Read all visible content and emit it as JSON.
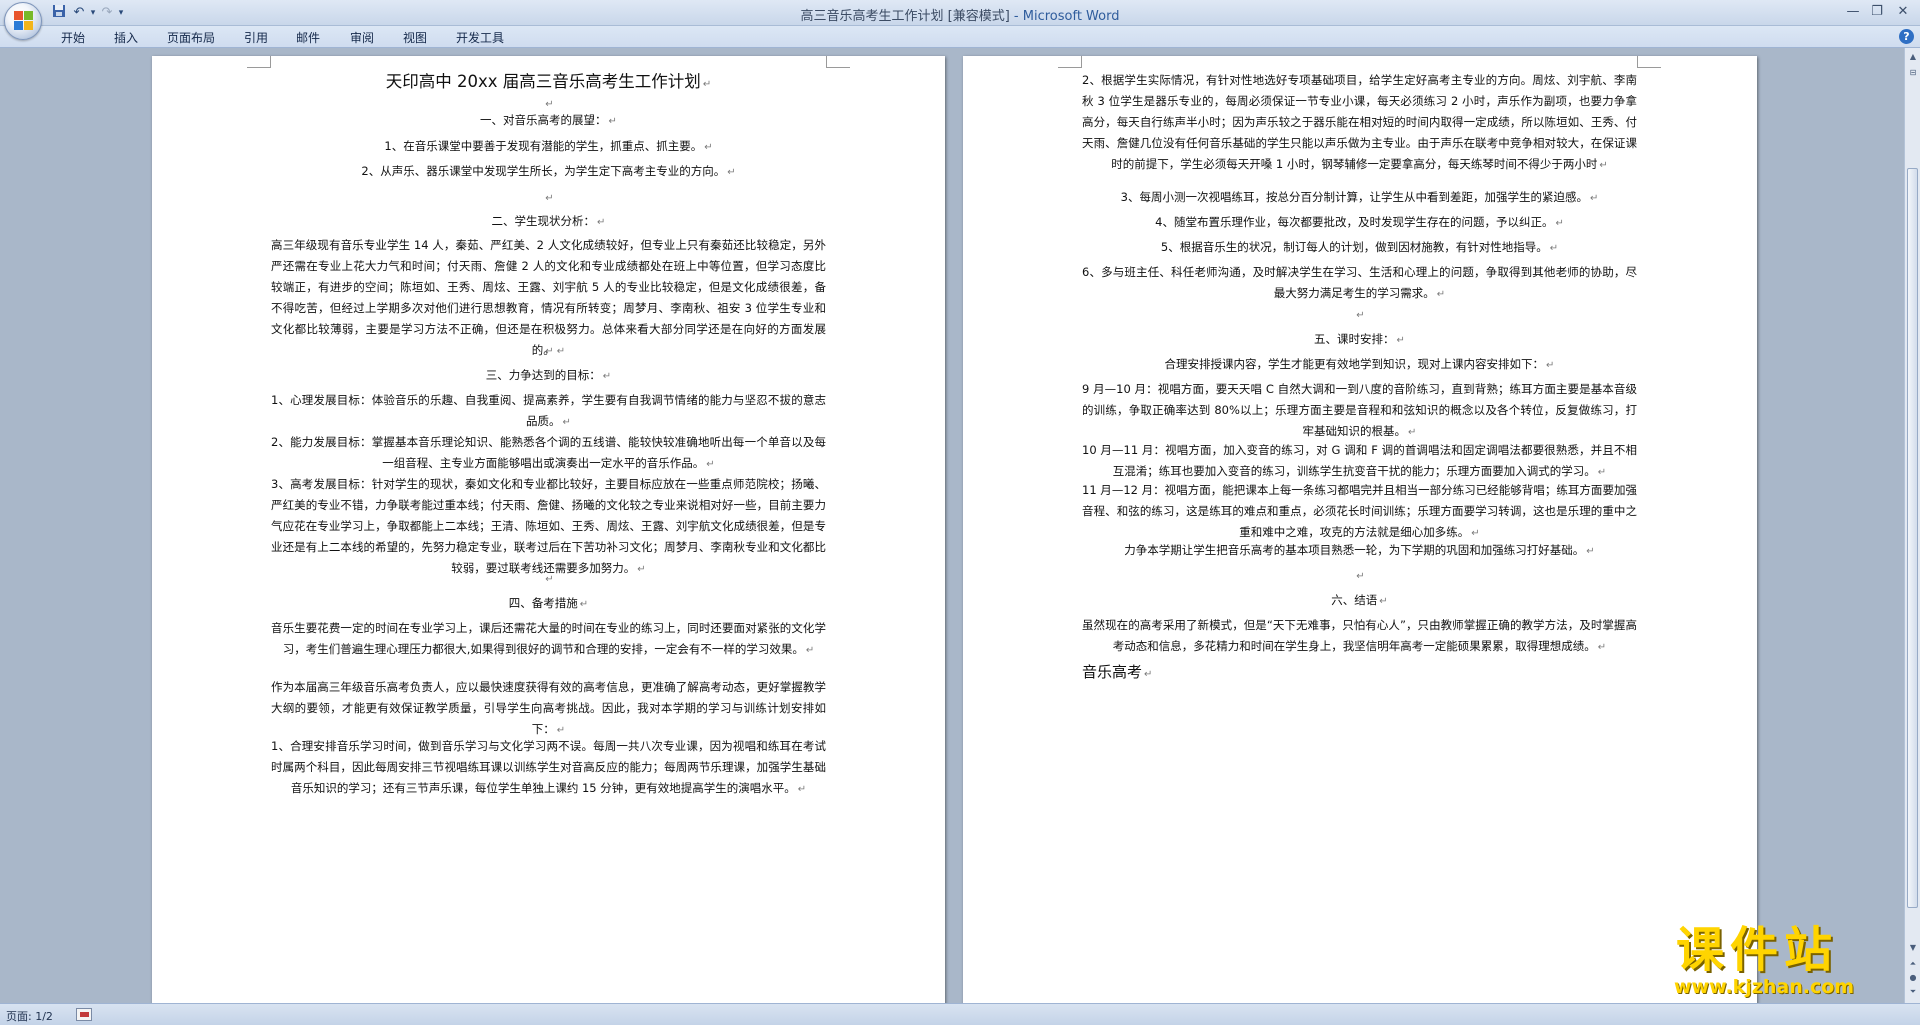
{
  "window": {
    "document_name": "高三音乐高考生工作计划 [兼容模式]",
    "separator": " - ",
    "app_name": "Microsoft Word"
  },
  "ribbon_tabs": [
    "开始",
    "插入",
    "页面布局",
    "引用",
    "邮件",
    "审阅",
    "视图",
    "开发工具"
  ],
  "status": {
    "page_indicator": "页面: 1/2"
  },
  "paragraph_mark": "↵",
  "page1": {
    "paragraphs": [
      {
        "text": "天印高中 20xx 届高三音乐高考生工作计划",
        "style": "title"
      },
      {
        "text": "",
        "style": "empty"
      },
      {
        "text": "一、对音乐高考的展望：",
        "style": "center"
      },
      {
        "text": "1、在音乐课堂中要善于发现有潜能的学生，抓重点、抓主要。",
        "style": "center"
      },
      {
        "text": "2、从声乐、器乐课堂中发现学生所长，为学生定下高考主专业的方向。",
        "style": "center"
      },
      {
        "text": "",
        "style": "empty"
      },
      {
        "text": "二、学生现状分析：",
        "style": "center"
      },
      {
        "text": "高三年级现有音乐专业学生 14 人，秦茹、严红美、2 人文化成绩较好，但专业上只有秦茹还比较稳定，另外严还需在专业上花大力气和时间；付天雨、詹健 2 人的文化和专业成绩都处在班上中等位置，但学习态度比较端正，有进步的空间；陈垣如、王秀、周炫、王露、刘宇航 5 人的专业比较稳定，但是文化成绩很差，备不得吃苦，但经过上学期多次对他们进行思想教育，情况有所转变；周梦月、李南秋、祖安 3 位学生专业和文化都比较薄弱，主要是学习方法不正确，但还是在积极努力。总体来看大部分同学还是在向好的方面发展的。",
        "style": "just"
      },
      {
        "text": "",
        "style": "empty"
      },
      {
        "text": "三、力争达到的目标：",
        "style": "center"
      },
      {
        "text": "1、心理发展目标：体验音乐的乐趣、自我重阅、提高素养，学生要有自我调节情绪的能力与坚忍不拔的意志品质。",
        "style": "just"
      },
      {
        "text": "2、能力发展目标：掌握基本音乐理论知识、能熟悉各个调的五线谱、能较快较准确地听出每一个单音以及每一组音程、主专业方面能够唱出或演奏出一定水平的音乐作品。",
        "style": "just"
      },
      {
        "text": "3、高考发展目标：针对学生的现状，秦如文化和专业都比较好，主要目标应放在一些重点师范院校；扬曦、严红美的专业不错，力争联考能过重本线；付天雨、詹健、扬曦的文化较之专业来说相对好一些，目前主要力气应花在专业学习上，争取都能上二本线；王清、陈垣如、王秀、周炫、王露、刘宇航文化成绩很差，但是专业还是有上二本线的希望的，先努力稳定专业，联考过后在下苦功补习文化；周梦月、李南秋专业和文化都比较弱，要过联考线还需要多加努力。",
        "style": "just"
      },
      {
        "text": "",
        "style": "empty"
      },
      {
        "text": "四、备考措施",
        "style": "center"
      },
      {
        "text": "音乐生要花费一定的时间在专业学习上，课后还需花大量的时间在专业的练习上，同时还要面对紧张的文化学习，考生们普遍生理心理压力都很大,如果得到很好的调节和合理的安排，一定会有不一样的学习效果。",
        "style": "just"
      },
      {
        "text": "作为本届高三年级音乐高考负责人，应以最快速度获得有效的高考信息，更准确了解高考动态，更好掌握教学大纲的要领，才能更有效保证教学质量，引导学生向高考挑战。因此，我对本学期的学习与训练计划安排如下：",
        "style": "just"
      },
      {
        "text": "1、合理安排音乐学习时间，做到音乐学习与文化学习两不误。每周一共八次专业课，因为视唱和练耳在考试时属两个科目，因此每周安排三节视唱练耳课以训练学生对音高反应的能力；每周两节乐理课，加强学生基础音乐知识的学习；还有三节声乐课，每位学生单独上课约 15 分钟，更有效地提高学生的演唱水平。",
        "style": "just"
      }
    ]
  },
  "page2": {
    "paragraphs": [
      {
        "text": "2、根据学生实际情况，有针对性地选好专项基础项目，给学生定好高考主专业的方向。周炫、刘宇航、李南秋 3 位学生是器乐专业的，每周必须保证一节专业小课，每天必须练习 2 小时，声乐作为副项，也要力争拿高分，每天自行练声半小时；因为声乐较之于器乐能在相对短的时间内取得一定成绩，所以陈垣如、王秀、付天雨、詹健几位没有任何音乐基础的学生只能以声乐做为主专业。由于声乐在联考中竞争相对较大，在保证课时的前提下，学生必须每天开嗓 1 小时，钢琴辅修一定要拿高分，每天练琴时间不得少于两小时",
        "style": "just"
      },
      {
        "text": "3、每周小测一次视唱练耳，按总分百分制计算，让学生从中看到差距，加强学生的紧迫感。",
        "style": "center"
      },
      {
        "text": "4、随堂布置乐理作业，每次都要批改，及时发现学生存在的问题，予以纠正。",
        "style": "center"
      },
      {
        "text": "5、根据音乐生的状况，制订每人的计划，做到因材施教，有针对性地指导。",
        "style": "center"
      },
      {
        "text": "6、多与班主任、科任老师沟通，及时解决学生在学习、生活和心理上的问题，争取得到其他老师的协助，尽最大努力满足考生的学习需求。",
        "style": "just"
      },
      {
        "text": "",
        "style": "empty"
      },
      {
        "text": "五、课时安排：",
        "style": "center"
      },
      {
        "text": "合理安排授课内容，学生才能更有效地学到知识，现对上课内容安排如下：",
        "style": "center"
      },
      {
        "text": "9 月—10 月：视唱方面，要天天唱 C 自然大调和一到八度的音阶练习，直到背熟；练耳方面主要是基本音级的训练，争取正确率达到 80%以上；乐理方面主要是音程和和弦知识的概念以及各个转位，反复做练习，打牢基础知识的根基。",
        "style": "just"
      },
      {
        "text": "10 月—11 月：视唱方面，加入变音的练习，对 G 调和 F 调的首调唱法和固定调唱法都要很熟悉，并且不相互混淆；练耳也要加入变音的练习，训练学生抗变音干扰的能力；乐理方面要加入调式的学习。",
        "style": "just"
      },
      {
        "text": "11 月—12 月：视唱方面，能把课本上每一条练习都唱完并且相当一部分练习已经能够背唱；练耳方面要加强音程、和弦的练习，这是练耳的难点和重点，必须花长时间训练；乐理方面要学习转调，这也是乐理的重中之重和难中之难，攻克的方法就是细心加多练。",
        "style": "just"
      },
      {
        "text": "力争本学期让学生把音乐高考的基本项目熟悉一轮，为下学期的巩固和加强练习打好基础。",
        "style": "center"
      },
      {
        "text": "",
        "style": "empty"
      },
      {
        "text": "六、结语",
        "style": "center"
      },
      {
        "text": "虽然现在的高考采用了新模式，但是“天下无难事，只怕有心人”，只由教师掌握正确的教学方法，及时掌握高考动态和信息，多花精力和时间在学生身上，我坚信明年高考一定能硕果累累，取得理想成绩。",
        "style": "just"
      },
      {
        "text": "音乐高考",
        "style": "bigleft"
      }
    ]
  },
  "watermark": {
    "title": "课件站",
    "url": "www.kjzhan.com"
  }
}
